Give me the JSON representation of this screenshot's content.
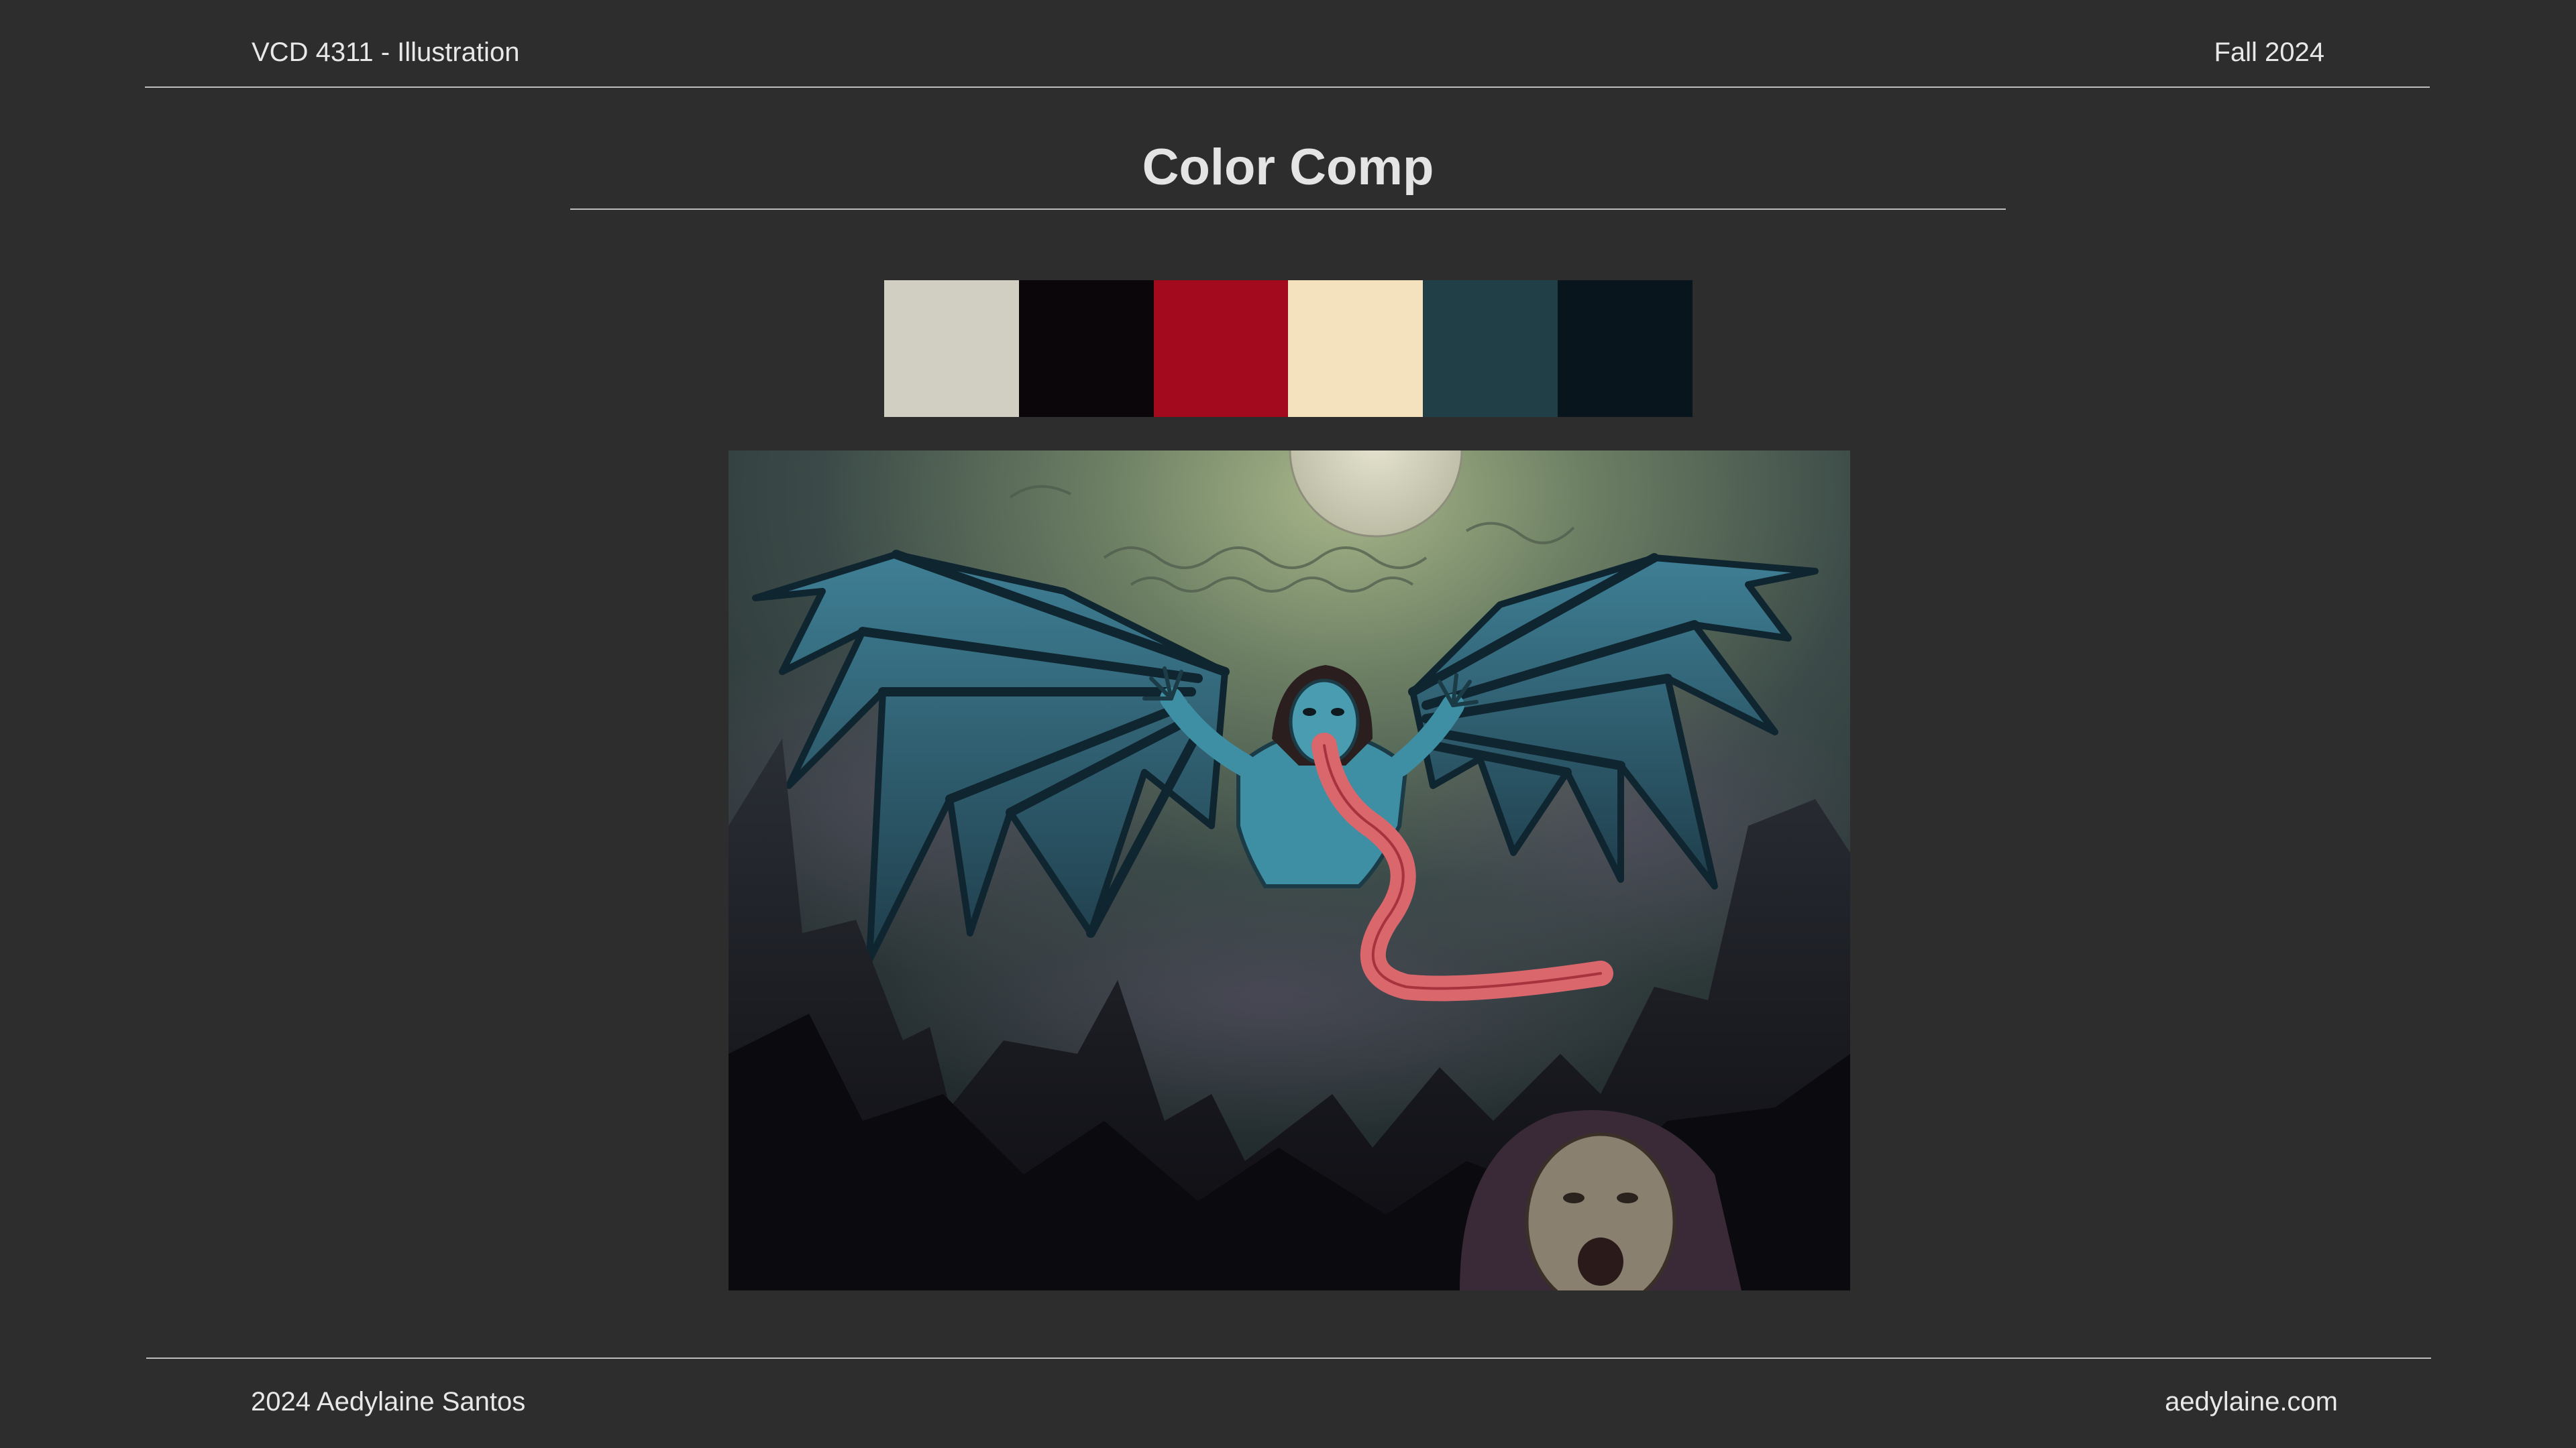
{
  "header": {
    "course": "VCD 4311 - Illustration",
    "term": "Fall 2024"
  },
  "title": "Color Comp",
  "palette": {
    "swatches": [
      {
        "name": "pale-gray",
        "color": "#d0cfc2"
      },
      {
        "name": "near-black",
        "color": "#0a0609"
      },
      {
        "name": "crimson",
        "color": "#a30a1e"
      },
      {
        "name": "cream",
        "color": "#f4e1bd"
      },
      {
        "name": "dark-teal",
        "color": "#213f47"
      },
      {
        "name": "deep-navy",
        "color": "#08151d"
      }
    ]
  },
  "artwork": {
    "icon": "illustration-winged-creature"
  },
  "footer": {
    "copyright": "2024 Aedylaine Santos",
    "website": "aedylaine.com"
  }
}
